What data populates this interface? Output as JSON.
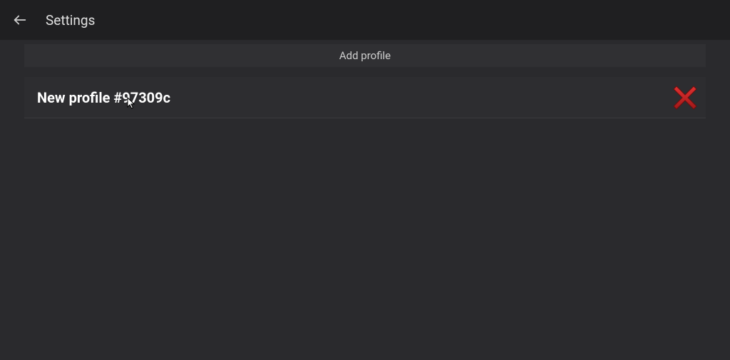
{
  "header": {
    "title": "Settings"
  },
  "actions": {
    "add_profile_label": "Add profile"
  },
  "profiles": [
    {
      "name": "New profile #97309c"
    }
  ],
  "icons": {
    "back": "back-arrow",
    "delete": "close-x"
  },
  "colors": {
    "delete_red": "#c92a2a",
    "delete_red_dark": "#8b1a1a"
  }
}
